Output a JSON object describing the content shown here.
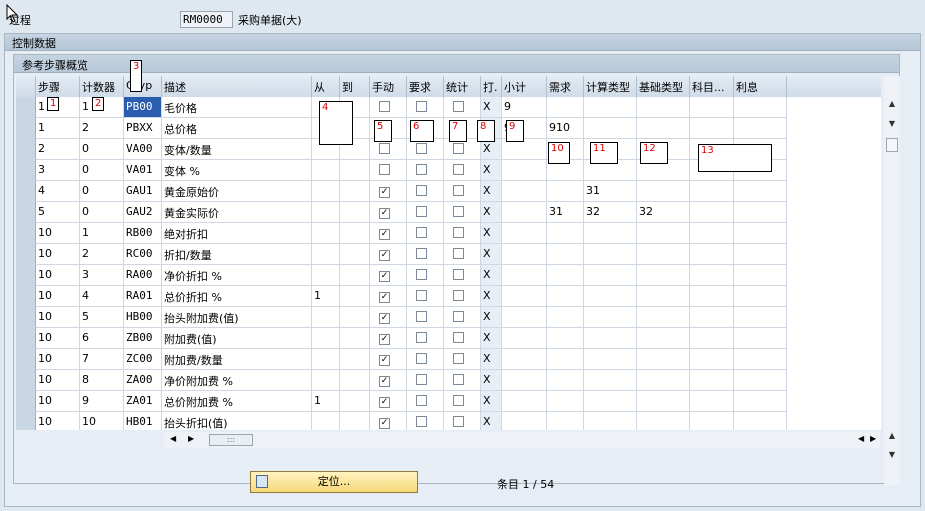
{
  "header": {
    "process_label": "过程",
    "process_value": "RM0000",
    "process_desc": "采购单据(大)"
  },
  "frame": {
    "title": "控制数据"
  },
  "box": {
    "title": "参考步骤概览"
  },
  "columns": [
    "步骤",
    "计数器",
    "CTyp",
    "描述",
    "从",
    "到",
    "手动",
    "要求",
    "统计",
    "打.",
    "小计",
    "需求",
    "计算类型",
    "基础类型",
    "科目...",
    "利息"
  ],
  "rows": [
    {
      "step": "1",
      "ctr": "1",
      "ctyp": "PB00",
      "desc": "毛价格",
      "from": "",
      "to": "",
      "manual": false,
      "req": false,
      "stat": false,
      "print": "X",
      "subtotal": "9",
      "reqt": "",
      "calc": "",
      "base": "",
      "acct": "",
      "interest": ""
    },
    {
      "step": "1",
      "ctr": "2",
      "ctyp": "PBXX",
      "desc": "总价格",
      "from": "",
      "to": "",
      "manual": false,
      "req": false,
      "stat": false,
      "print": "X",
      "subtotal": "9",
      "reqt": "910",
      "calc": "",
      "base": "",
      "acct": "",
      "interest": ""
    },
    {
      "step": "2",
      "ctr": "0",
      "ctyp": "VA00",
      "desc": "变体/数量",
      "from": "",
      "to": "",
      "manual": false,
      "req": false,
      "stat": false,
      "print": "X",
      "subtotal": "",
      "reqt": "",
      "calc": "",
      "base": "",
      "acct": "",
      "interest": ""
    },
    {
      "step": "3",
      "ctr": "0",
      "ctyp": "VA01",
      "desc": "变体 %",
      "from": "",
      "to": "",
      "manual": false,
      "req": false,
      "stat": false,
      "print": "X",
      "subtotal": "",
      "reqt": "",
      "calc": "",
      "base": "",
      "acct": "",
      "interest": ""
    },
    {
      "step": "4",
      "ctr": "0",
      "ctyp": "GAU1",
      "desc": "黄金原始价",
      "from": "",
      "to": "",
      "manual": true,
      "req": false,
      "stat": false,
      "print": "X",
      "subtotal": "",
      "reqt": "",
      "calc": "31",
      "base": "",
      "acct": "",
      "interest": ""
    },
    {
      "step": "5",
      "ctr": "0",
      "ctyp": "GAU2",
      "desc": "黄金实际价",
      "from": "",
      "to": "",
      "manual": true,
      "req": false,
      "stat": false,
      "print": "X",
      "subtotal": "",
      "reqt": "31",
      "calc": "32",
      "base": "32",
      "acct": "",
      "interest": ""
    },
    {
      "step": "10",
      "ctr": "1",
      "ctyp": "RB00",
      "desc": "绝对折扣",
      "from": "",
      "to": "",
      "manual": true,
      "req": false,
      "stat": false,
      "print": "X",
      "subtotal": "",
      "reqt": "",
      "calc": "",
      "base": "",
      "acct": "",
      "interest": ""
    },
    {
      "step": "10",
      "ctr": "2",
      "ctyp": "RC00",
      "desc": "折扣/数量",
      "from": "",
      "to": "",
      "manual": true,
      "req": false,
      "stat": false,
      "print": "X",
      "subtotal": "",
      "reqt": "",
      "calc": "",
      "base": "",
      "acct": "",
      "interest": ""
    },
    {
      "step": "10",
      "ctr": "3",
      "ctyp": "RA00",
      "desc": "净价折扣 %",
      "from": "",
      "to": "",
      "manual": true,
      "req": false,
      "stat": false,
      "print": "X",
      "subtotal": "",
      "reqt": "",
      "calc": "",
      "base": "",
      "acct": "",
      "interest": ""
    },
    {
      "step": "10",
      "ctr": "4",
      "ctyp": "RA01",
      "desc": "总价折扣 %",
      "from": "1",
      "to": "",
      "manual": true,
      "req": false,
      "stat": false,
      "print": "X",
      "subtotal": "",
      "reqt": "",
      "calc": "",
      "base": "",
      "acct": "",
      "interest": ""
    },
    {
      "step": "10",
      "ctr": "5",
      "ctyp": "HB00",
      "desc": "抬头附加费(值)",
      "from": "",
      "to": "",
      "manual": true,
      "req": false,
      "stat": false,
      "print": "X",
      "subtotal": "",
      "reqt": "",
      "calc": "",
      "base": "",
      "acct": "",
      "interest": ""
    },
    {
      "step": "10",
      "ctr": "6",
      "ctyp": "ZB00",
      "desc": "附加费(值)",
      "from": "",
      "to": "",
      "manual": true,
      "req": false,
      "stat": false,
      "print": "X",
      "subtotal": "",
      "reqt": "",
      "calc": "",
      "base": "",
      "acct": "",
      "interest": ""
    },
    {
      "step": "10",
      "ctr": "7",
      "ctyp": "ZC00",
      "desc": "附加费/数量",
      "from": "",
      "to": "",
      "manual": true,
      "req": false,
      "stat": false,
      "print": "X",
      "subtotal": "",
      "reqt": "",
      "calc": "",
      "base": "",
      "acct": "",
      "interest": ""
    },
    {
      "step": "10",
      "ctr": "8",
      "ctyp": "ZA00",
      "desc": "净价附加费 %",
      "from": "",
      "to": "",
      "manual": true,
      "req": false,
      "stat": false,
      "print": "X",
      "subtotal": "",
      "reqt": "",
      "calc": "",
      "base": "",
      "acct": "",
      "interest": ""
    },
    {
      "step": "10",
      "ctr": "9",
      "ctyp": "ZA01",
      "desc": "总价附加费 %",
      "from": "1",
      "to": "",
      "manual": true,
      "req": false,
      "stat": false,
      "print": "X",
      "subtotal": "",
      "reqt": "",
      "calc": "",
      "base": "",
      "acct": "",
      "interest": ""
    },
    {
      "step": "10",
      "ctr": "10",
      "ctyp": "HB01",
      "desc": "抬头折扣(值)",
      "from": "",
      "to": "",
      "manual": true,
      "req": false,
      "stat": false,
      "print": "X",
      "subtotal": "",
      "reqt": "",
      "calc": "",
      "base": "",
      "acct": "",
      "interest": ""
    }
  ],
  "footer": {
    "position_button": "定位...",
    "entry_count": "条目 1 / 54"
  },
  "annotations": [
    "1",
    "2",
    "3",
    "4",
    "5",
    "6",
    "7",
    "8",
    "9",
    "10",
    "11",
    "12",
    "13"
  ],
  "icons": {
    "column_settings": "table-settings-icon",
    "position": "locate-icon"
  },
  "colors": {
    "header_bg": "#cfdbe7",
    "frame_bg": "#e6edf4",
    "button_bg": "#f6d87a"
  }
}
